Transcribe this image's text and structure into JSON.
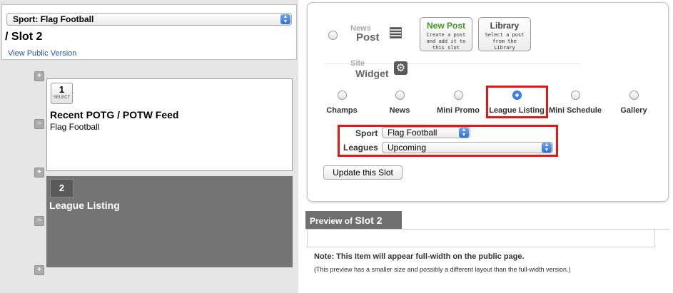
{
  "left": {
    "sport_select": "Sport: Flag Football",
    "slot_title": "/ Slot 2",
    "view_public": "View Public Version",
    "slot1": {
      "number": "1",
      "select_label": "SELECT",
      "title": "Recent POTG / POTW Feed",
      "subtitle": "Flag Football"
    },
    "slot2": {
      "number": "2",
      "title": "League Listing"
    },
    "controls": {
      "add": "+",
      "remove": "−"
    }
  },
  "editor": {
    "news_small": "News",
    "news_big": "Post",
    "new_post": {
      "title": "New Post",
      "desc": "Create a post and add it to this slot"
    },
    "library": {
      "title": "Library",
      "desc": "Select a post from the Library"
    },
    "site_small": "Site",
    "site_big": "Widget",
    "widget_options": [
      {
        "label": "Champs",
        "checked": false
      },
      {
        "label": "News",
        "checked": false
      },
      {
        "label": "Mini Promo",
        "checked": false
      },
      {
        "label": "League Listing",
        "checked": true
      },
      {
        "label": "Mini Schedule",
        "checked": false
      },
      {
        "label": "Gallery",
        "checked": false
      }
    ],
    "sport_label": "Sport",
    "sport_value": "Flag Football",
    "leagues_label": "Leagues",
    "leagues_value": "Upcoming",
    "update_button": "Update this Slot",
    "highlight_color": "#e41616"
  },
  "preview": {
    "tab_prefix": "Preview of",
    "tab_slot": "Slot 2",
    "note_bold": "Note: This Item will appear full-width on the public page.",
    "note_small": "(This preview has a smaller size and possibly a different layout than the full-width version.)"
  },
  "colors": {
    "accent_blue": "#2e6fd6",
    "new_post_green": "#3a9a1a",
    "slot_selected_bg": "#747474",
    "left_bg": "#e6e6e6"
  }
}
